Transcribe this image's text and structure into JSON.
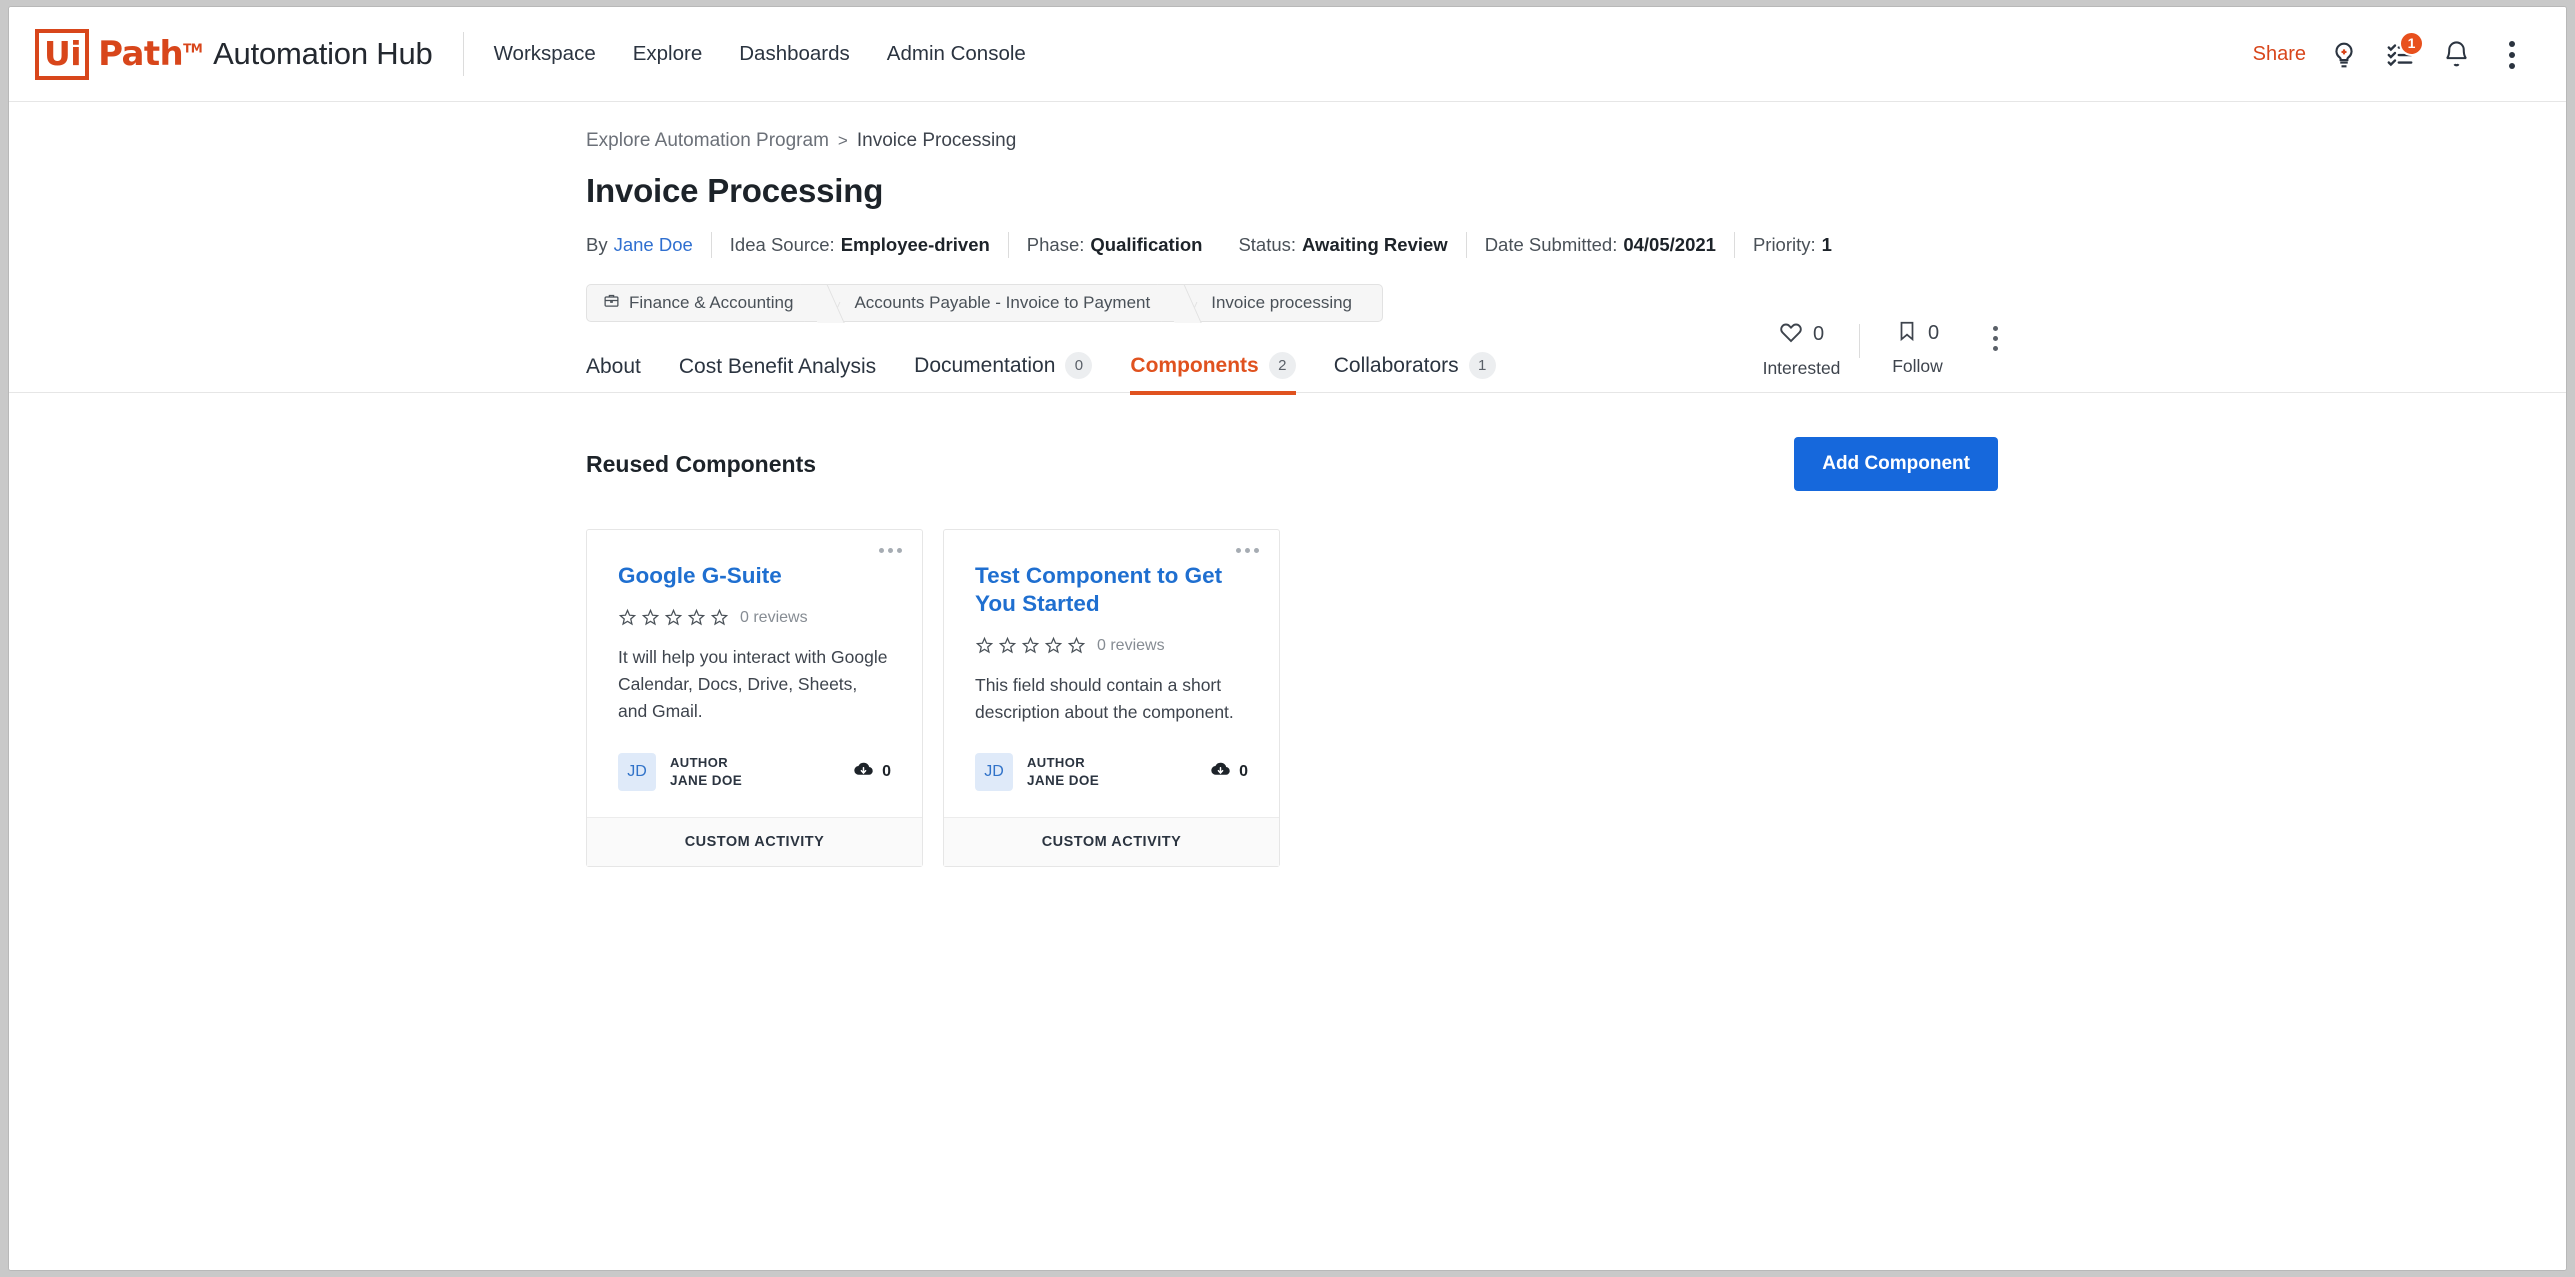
{
  "header": {
    "logo": {
      "ui": "Ui",
      "path": "Path",
      "tm": "TM",
      "product": "Automation Hub"
    },
    "nav": [
      {
        "label": "Workspace",
        "name": "nav-workspace"
      },
      {
        "label": "Explore",
        "name": "nav-explore"
      },
      {
        "label": "Dashboards",
        "name": "nav-dashboards"
      },
      {
        "label": "Admin Console",
        "name": "nav-admin-console"
      }
    ],
    "share_label": "Share",
    "tasks_badge": "1",
    "icons": [
      "lightbulb-plus-icon",
      "task-list-icon",
      "bell-icon",
      "overflow-menu-icon"
    ],
    "accent_color": "#d8461b"
  },
  "breadcrumb": {
    "parent": "Explore Automation Program",
    "separator": ">",
    "current": "Invoice Processing"
  },
  "page": {
    "title": "Invoice Processing"
  },
  "meta": {
    "by_label": "By",
    "author": "Jane Doe",
    "items": [
      {
        "label": "Idea Source:",
        "value": "Employee-driven"
      },
      {
        "label": "Phase:",
        "value": "Qualification"
      },
      {
        "label": "Status:",
        "value": "Awaiting Review"
      },
      {
        "label": "Date Submitted:",
        "value": "04/05/2021"
      },
      {
        "label": "Priority:",
        "value": "1"
      }
    ]
  },
  "engagement": {
    "interested": {
      "count": "0",
      "label": "Interested",
      "icon": "heart-icon"
    },
    "follow": {
      "count": "0",
      "label": "Follow",
      "icon": "bookmark-icon"
    }
  },
  "trail": [
    {
      "label": "Finance & Accounting",
      "icon": "briefcase-icon"
    },
    {
      "label": "Accounts Payable - Invoice to Payment",
      "icon": ""
    },
    {
      "label": "Invoice processing",
      "icon": ""
    }
  ],
  "tabs": [
    {
      "label": "About",
      "count": "",
      "active": false,
      "name": "tab-about"
    },
    {
      "label": "Cost Benefit Analysis",
      "count": "",
      "active": false,
      "name": "tab-cost-benefit-analysis"
    },
    {
      "label": "Documentation",
      "count": "0",
      "active": false,
      "name": "tab-documentation"
    },
    {
      "label": "Components",
      "count": "2",
      "active": true,
      "name": "tab-components"
    },
    {
      "label": "Collaborators",
      "count": "1",
      "active": false,
      "name": "tab-collaborators"
    }
  ],
  "section": {
    "title": "Reused Components",
    "add_button": "Add Component",
    "add_button_color": "#1668dc"
  },
  "cards": [
    {
      "title": "Google G-Suite",
      "stars": 0,
      "max_stars": 5,
      "reviews": "0 reviews",
      "description": "It will help you interact with Google Calendar, Docs, Drive, Sheets, and Gmail.",
      "author_kicker": "AUTHOR",
      "author_name": "JANE DOE",
      "avatar_initials": "JD",
      "downloads": "0",
      "footer": "CUSTOM ACTIVITY"
    },
    {
      "title": "Test Component to Get You Started",
      "stars": 0,
      "max_stars": 5,
      "reviews": "0 reviews",
      "description": "This field should contain a short description about the component.",
      "author_kicker": "AUTHOR",
      "author_name": "JANE DOE",
      "avatar_initials": "JD",
      "downloads": "0",
      "footer": "CUSTOM ACTIVITY"
    }
  ]
}
